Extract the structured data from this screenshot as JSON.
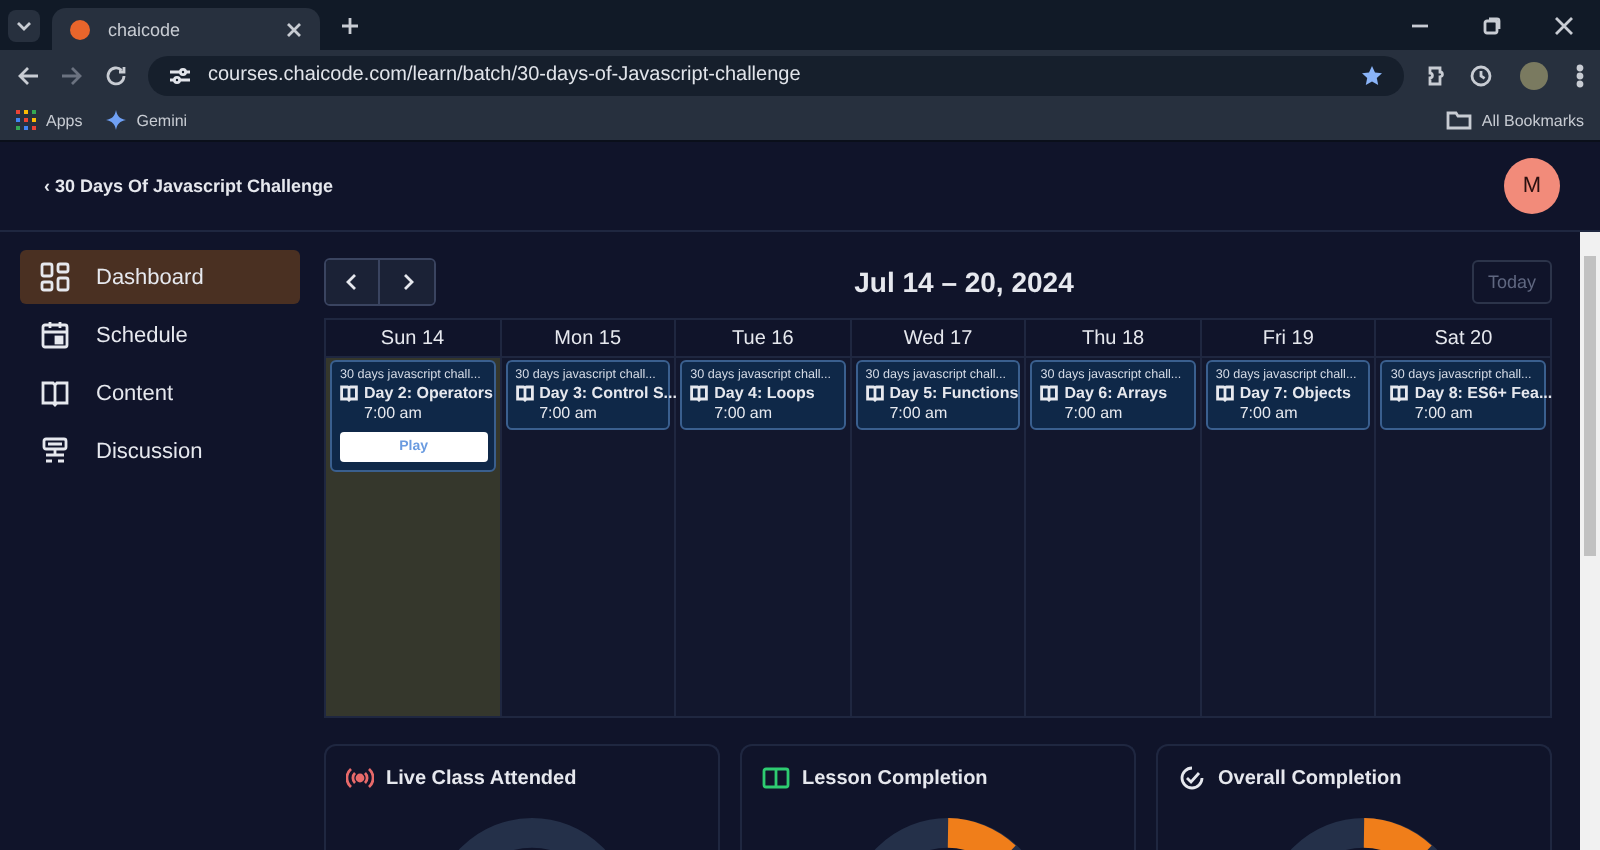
{
  "browser": {
    "tab_title": "chaicode",
    "url": "courses.chaicode.com/learn/batch/30-days-of-Javascript-challenge",
    "bookmarks": [
      {
        "label": "Apps",
        "kind": "apps"
      },
      {
        "label": "Gemini",
        "kind": "gemini"
      }
    ],
    "all_bookmarks": "All Bookmarks"
  },
  "header": {
    "back_link": "‹ 30 Days Of Javascript Challenge",
    "avatar": "M"
  },
  "sidebar": {
    "items": [
      {
        "label": "Dashboard",
        "kind": "dashboard",
        "selected": true
      },
      {
        "label": "Schedule",
        "kind": "schedule",
        "selected": false
      },
      {
        "label": "Content",
        "kind": "content",
        "selected": false
      },
      {
        "label": "Discussion",
        "kind": "discussion",
        "selected": false
      }
    ]
  },
  "calendar": {
    "title": "Jul 14 – 20, 2024",
    "today_button": {
      "label": "Today",
      "disabled": true
    },
    "days": [
      {
        "label": "Sun 14",
        "selected": true,
        "events": [
          {
            "course": "30 days javascript chall...",
            "title": "Day 2: Operators",
            "time": "7:00 am",
            "button": "Play"
          }
        ]
      },
      {
        "label": "Mon 15",
        "selected": false,
        "events": [
          {
            "course": "30 days javascript chall...",
            "title": "Day 3: Control S...",
            "time": "7:00 am"
          }
        ]
      },
      {
        "label": "Tue 16",
        "selected": false,
        "events": [
          {
            "course": "30 days javascript chall...",
            "title": "Day 4: Loops",
            "time": "7:00 am"
          }
        ]
      },
      {
        "label": "Wed 17",
        "selected": false,
        "events": [
          {
            "course": "30 days javascript chall...",
            "title": "Day 5: Functions",
            "time": "7:00 am"
          }
        ]
      },
      {
        "label": "Thu 18",
        "selected": false,
        "events": [
          {
            "course": "30 days javascript chall...",
            "title": "Day 6: Arrays",
            "time": "7:00 am"
          }
        ]
      },
      {
        "label": "Fri 19",
        "selected": false,
        "events": [
          {
            "course": "30 days javascript chall...",
            "title": "Day 7: Objects",
            "time": "7:00 am"
          }
        ]
      },
      {
        "label": "Sat 20",
        "selected": false,
        "events": [
          {
            "course": "30 days javascript chall...",
            "title": "Day 8: ES6+ Fea...",
            "time": "7:00 am"
          }
        ]
      }
    ]
  },
  "stats": [
    {
      "title": "Live Class Attended",
      "kind": "live",
      "progress": false
    },
    {
      "title": "Lesson Completion",
      "kind": "lesson",
      "progress": true
    },
    {
      "title": "Overall Completion",
      "kind": "overall",
      "progress": true
    }
  ]
}
